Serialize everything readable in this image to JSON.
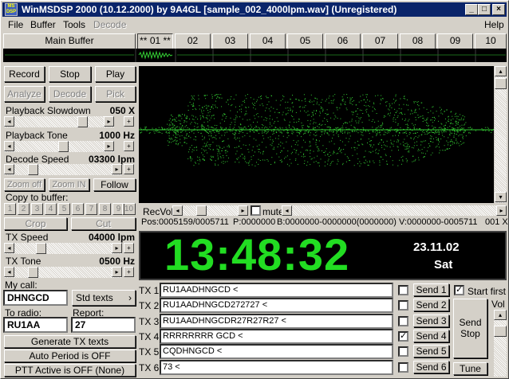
{
  "title": "WinMSDSP 2000 (10.12.2000) by 9A4GL [sample_002_4000lpm.wav] (Unregistered)",
  "app_icon": "MS DSP",
  "window_controls": {
    "minimize": "_",
    "maximize": "□",
    "close": "×"
  },
  "menu": [
    "File",
    "Buffer",
    "Tools",
    "Decode",
    "Help"
  ],
  "tabs": [
    "Main Buffer",
    "** 01 **",
    "02",
    "03",
    "04",
    "05",
    "06",
    "07",
    "08",
    "09",
    "10"
  ],
  "controls": {
    "record": "Record",
    "stop": "Stop",
    "play": "Play",
    "analyze": "Analyze",
    "decode": "Decode",
    "pick": "Pick"
  },
  "playback_slowdown": {
    "label": "Playback Slowdown",
    "value": "050 X"
  },
  "playback_tone": {
    "label": "Playback Tone",
    "value": "1000 Hz"
  },
  "decode_speed": {
    "label": "Decode Speed",
    "value": "03300 lpm"
  },
  "zoom": {
    "off": "Zoom off",
    "in": "Zoom IN",
    "follow": "Follow"
  },
  "copy_to_buffer": {
    "label": "Copy to buffer:",
    "buttons": [
      "1",
      "2",
      "3",
      "4",
      "5",
      "6",
      "7",
      "8",
      "9",
      "10"
    ],
    "crop": "Crop",
    "cut": "Cut"
  },
  "tx_speed": {
    "label": "TX Speed",
    "value": "04000 lpm"
  },
  "tx_tone": {
    "label": "TX Tone",
    "value": "0500 Hz"
  },
  "my_call": {
    "label": "My call:",
    "value": "DHNGCD",
    "std_texts": "Std texts"
  },
  "to_radio": {
    "label": "To radio:",
    "value": "RU1AA"
  },
  "report": {
    "label": "Report:",
    "value": "27"
  },
  "generate": "Generate TX texts",
  "auto_period": "Auto Period is OFF",
  "ptt": "PTT Active is OFF (None)",
  "recvol": {
    "label": "RecVol:",
    "mute": "mute"
  },
  "status": {
    "pos": "Pos:0005159/0005711",
    "p": "P:0000000",
    "b": "B:0000000-0000000(0000000)",
    "v": "V:0000000-0005711",
    "rate": "001 X"
  },
  "clock": {
    "time": "13:48:32",
    "date": "23.11.02",
    "day": "Sat"
  },
  "tx_rows": [
    {
      "label": "TX 1",
      "text": "RU1AADHNGCD <",
      "checked": false,
      "send": "Send 1"
    },
    {
      "label": "TX 2",
      "text": "RU1AADHNGCD272727 <",
      "checked": false,
      "send": "Send 2"
    },
    {
      "label": "TX 3",
      "text": "RU1AADHNGCDR27R27R27 <",
      "checked": false,
      "send": "Send 3"
    },
    {
      "label": "TX 4",
      "text": "RRRRRRRR GCD <",
      "checked": true,
      "send": "Send 4"
    },
    {
      "label": "TX 5",
      "text": "CQDHNGCD <",
      "checked": false,
      "send": "Send 5"
    },
    {
      "label": "TX 6",
      "text": "73 <",
      "checked": false,
      "send": "Send 6"
    }
  ],
  "start_first": "Start first",
  "send_stop": "Send Stop",
  "tune": "Tune",
  "vol": "Vol",
  "colors": {
    "waveform": "#33cc33",
    "clock": "#22dd22",
    "title_bg": "#0a246a"
  }
}
